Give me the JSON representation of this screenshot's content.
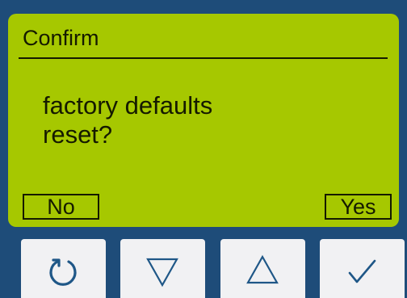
{
  "colors": {
    "frame": "#1e4c79",
    "lcd_background": "#a6c800",
    "lcd_text": "#151a00",
    "button_face": "#f1f1f3",
    "button_icon": "#1f5787"
  },
  "screen": {
    "title": "Confirm",
    "message_line1": "factory defaults",
    "message_line2": "reset?",
    "softkey_left": "No",
    "softkey_right": "Yes"
  },
  "buttons": [
    {
      "icon": "rotate-back-icon"
    },
    {
      "icon": "triangle-down-icon"
    },
    {
      "icon": "triangle-up-icon"
    },
    {
      "icon": "checkmark-icon"
    }
  ]
}
